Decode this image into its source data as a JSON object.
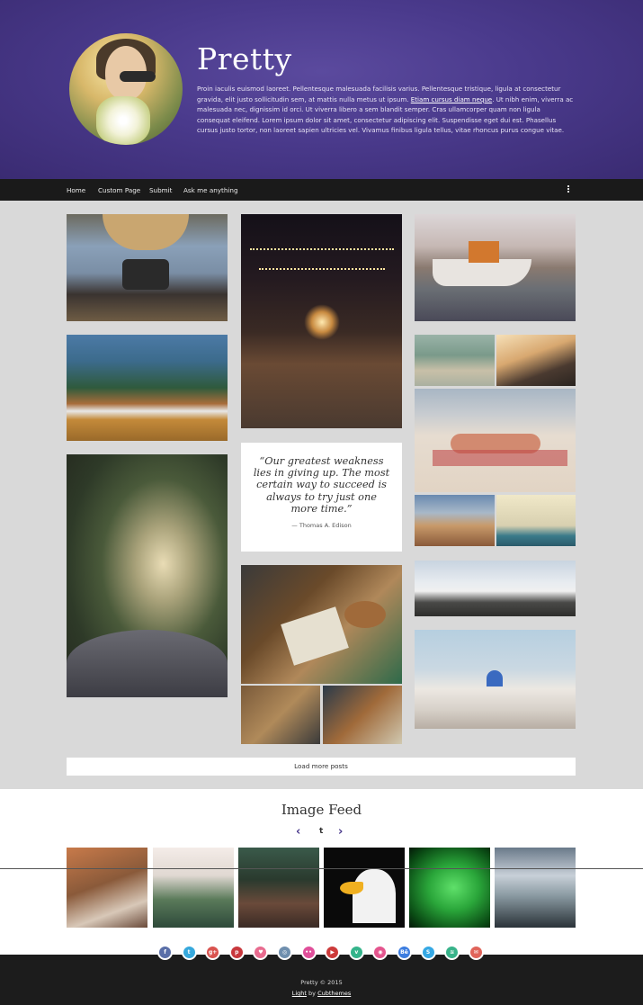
{
  "blog": {
    "title": "Pretty",
    "intro_before": "Proin iaculis euismod laoreet. Pellentesque malesuada facilisis varius. Pellentesque tristique, ligula at consectetur gravida, elit justo sollicitudin sem, at mattis nulla metus ut ipsum. ",
    "intro_link": "Etiam cursus diam neque",
    "intro_after": ". Ut nibh enim, viverra ac malesuada nec, dignissim id orci. Ut viverra libero a sem blandit semper. Cras ullamcorper quam non ligula consequat eleifend. Lorem ipsum dolor sit amet, consectetur adipiscing elit. Suspendisse eget dui est. Phasellus cursus justo tortor, non laoreet sapien ultricies vel. Vivamus finibus ligula tellus, vitae rhoncus purus congue vitae."
  },
  "nav": {
    "items": [
      {
        "label": "Home"
      },
      {
        "label": "Custom Page"
      },
      {
        "label": "Submit"
      },
      {
        "label": "Ask me anything"
      }
    ],
    "menu_icon": "more-vertical-icon"
  },
  "quote": {
    "text": "“Our greatest weakness lies in giving up. The most certain way to succeed is always to try just one more time.”",
    "author": "— Thomas A. Edison"
  },
  "load_more_label": "Load more posts",
  "feed": {
    "title": "Image Feed",
    "prev_icon": "chevron-left-icon",
    "next_icon": "chevron-right-icon",
    "logo_text": "t",
    "prev_glyph": "‹",
    "next_glyph": "›"
  },
  "social": [
    {
      "name": "facebook-icon",
      "glyph": "f",
      "color": "#5a6fa8"
    },
    {
      "name": "twitter-icon",
      "glyph": "t",
      "color": "#36a8dc"
    },
    {
      "name": "google-plus-icon",
      "glyph": "g+",
      "color": "#d9534f"
    },
    {
      "name": "pinterest-icon",
      "glyph": "p",
      "color": "#c8383d"
    },
    {
      "name": "heart-icon",
      "glyph": "♥",
      "color": "#e86b8f"
    },
    {
      "name": "instagram-icon",
      "glyph": "◎",
      "color": "#6f8fae"
    },
    {
      "name": "flickr-icon",
      "glyph": "••",
      "color": "#e04f9a"
    },
    {
      "name": "youtube-icon",
      "glyph": "▶",
      "color": "#cc3b3b"
    },
    {
      "name": "vine-icon",
      "glyph": "v",
      "color": "#35b48b"
    },
    {
      "name": "dribbble-icon",
      "glyph": "◉",
      "color": "#e4558e"
    },
    {
      "name": "behance-icon",
      "glyph": "Bē",
      "color": "#3c7de0"
    },
    {
      "name": "skype-icon",
      "glyph": "S",
      "color": "#35a8e4"
    },
    {
      "name": "spotify-icon",
      "glyph": "≋",
      "color": "#38b38a"
    },
    {
      "name": "email-icon",
      "glyph": "✉",
      "color": "#e0645a"
    }
  ],
  "footer": {
    "copyright": "Pretty © 2015",
    "theme_name": "Light",
    "theme_by": " by ",
    "theme_author": "Cubthemes"
  }
}
